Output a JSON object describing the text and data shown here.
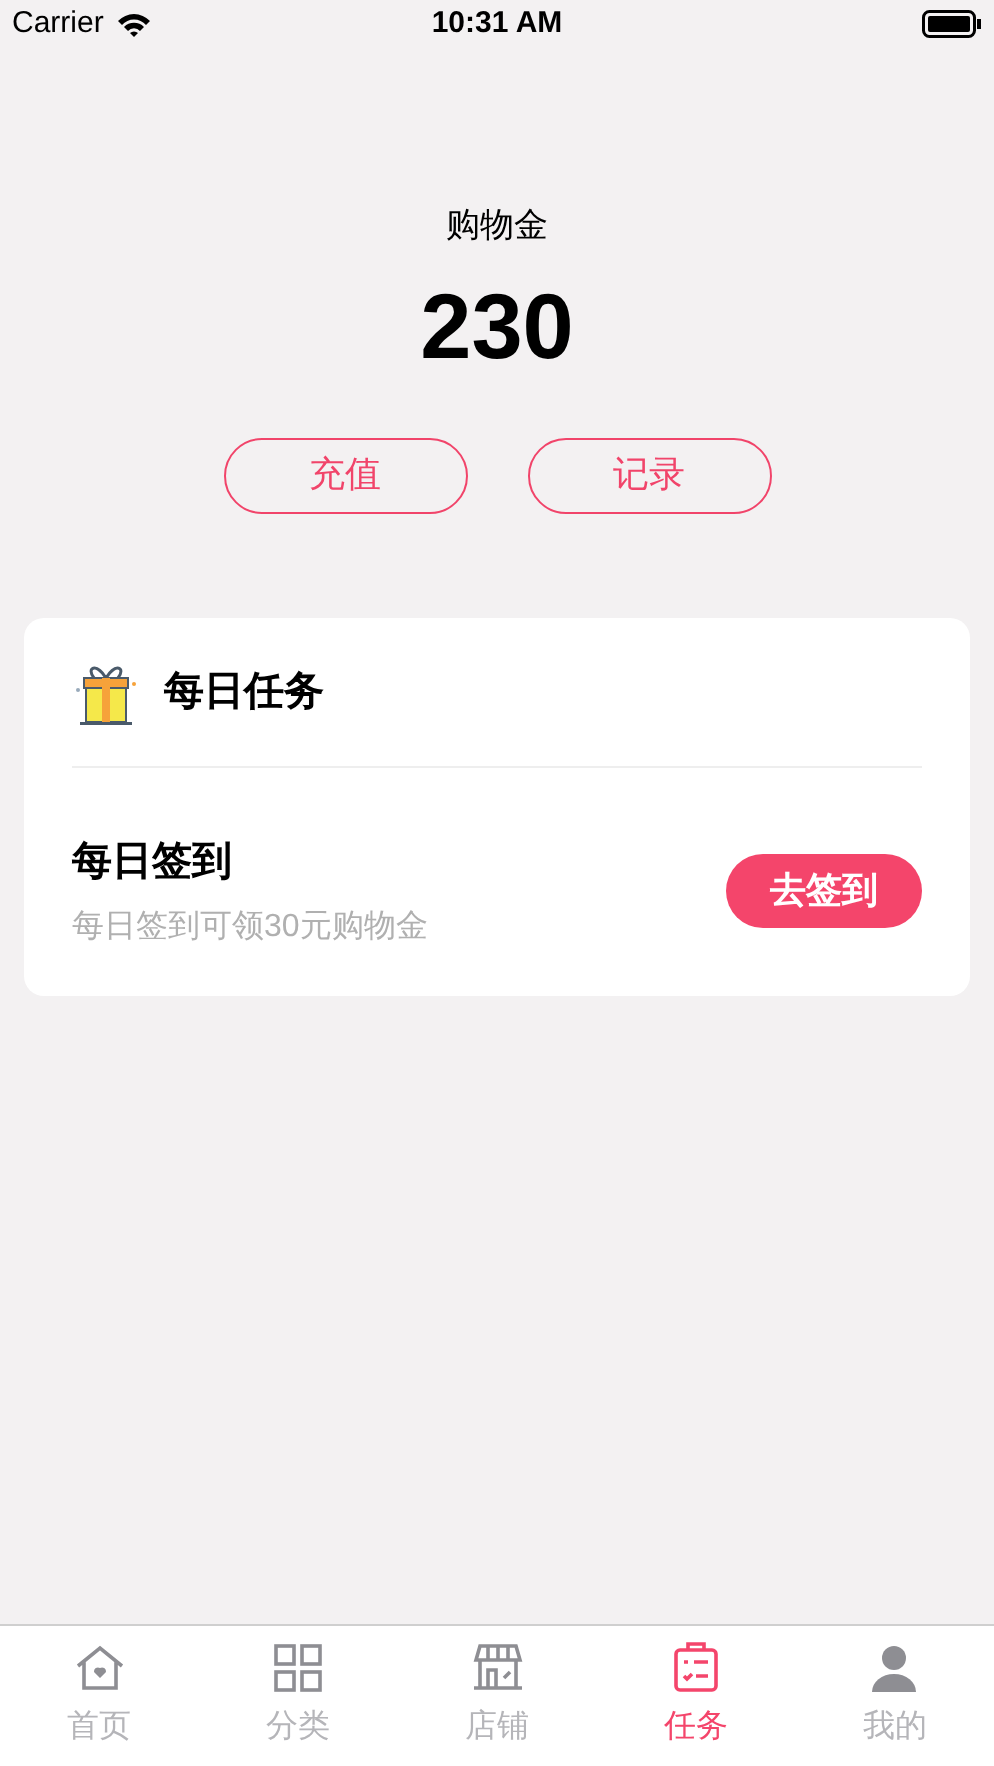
{
  "status_bar": {
    "carrier": "Carrier",
    "time": "10:31 AM"
  },
  "balance": {
    "title": "购物金",
    "amount": "230",
    "buttons": [
      "充值",
      "记录"
    ]
  },
  "task_card": {
    "title": "每日任务",
    "tasks": [
      {
        "name": "每日签到",
        "description": "每日签到可领30元购物金",
        "action": "去签到"
      }
    ]
  },
  "tab_bar": [
    {
      "label": "首页",
      "selected": false
    },
    {
      "label": "分类",
      "selected": false
    },
    {
      "label": "店铺",
      "selected": false
    },
    {
      "label": "任务",
      "selected": true
    },
    {
      "label": "我的",
      "selected": false
    }
  ]
}
